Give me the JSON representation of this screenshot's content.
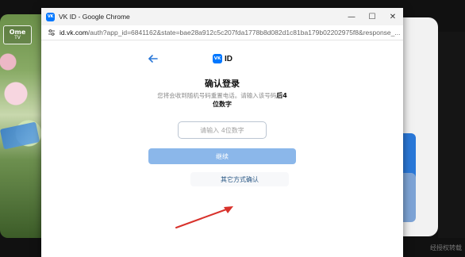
{
  "background": {
    "left_badge_line1": "Ome",
    "left_badge_line2": "TV",
    "bottom_text": "经授权转载"
  },
  "window": {
    "title": "VK ID - Google Chrome",
    "favicon_text": "VK",
    "controls": {
      "minimize": "—",
      "maximize": "☐",
      "close": "✕"
    },
    "address": {
      "host": "id.vk.com",
      "path": "/auth?app_id=6841162&state=bae28a912c5c207fda1778b8d082d1c81ba179b02202975f8&response_..."
    }
  },
  "page": {
    "brand_logo": "VK",
    "brand_text": "ID",
    "heading": "确认登录",
    "description_prefix": "您将会收到随机号码重置电话。请输入该号码",
    "description_bold": "后4",
    "description_suffix": "位数字",
    "code_placeholder": "请输入 4位数字",
    "continue_label": "继续",
    "other_method_label": "其它方式确认"
  },
  "colors": {
    "brand": "#0077ff",
    "button": "#8bb7ea",
    "arrow": "#d8322c"
  },
  "icons": {
    "back": "arrow-left-icon",
    "site_info": "tune-icon",
    "annotation": "red-arrow-icon"
  }
}
